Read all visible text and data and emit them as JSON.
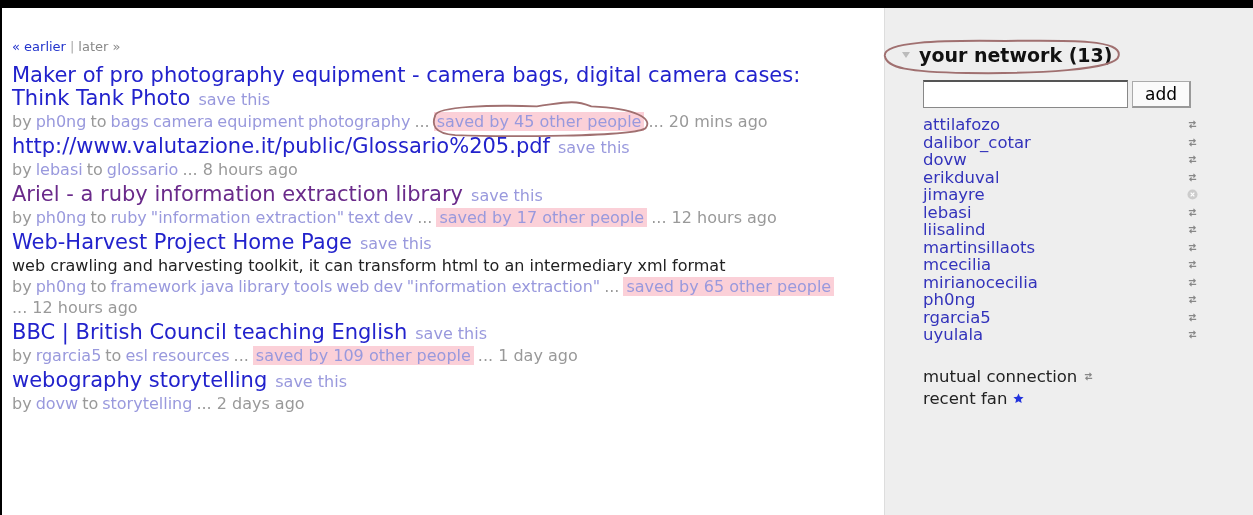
{
  "pager": {
    "earlier": "« earlier",
    "separator": "|",
    "later": "later »"
  },
  "bookmarks": [
    {
      "title_lines": [
        "Maker of pro photography equipment - camera bags, digital camera cases:",
        "Think Tank Photo"
      ],
      "visited": false,
      "save": "save this",
      "by": "by",
      "user": "ph0ng",
      "to": "to",
      "tags": [
        "bags",
        "camera",
        "equipment",
        "photography"
      ],
      "ellipsis": "...",
      "saved": "saved by 45 other people",
      "circled": true,
      "time": "... 20 mins ago"
    },
    {
      "title": "http://www.valutazione.it/public/Glossario%205.pdf",
      "visited": false,
      "save": "save this",
      "by": "by",
      "user": "lebasi",
      "to": "to",
      "tags": [
        "glossario"
      ],
      "time": "... 8 hours ago"
    },
    {
      "title": "Ariel - a ruby information extraction library",
      "visited": true,
      "save": "save this",
      "by": "by",
      "user": "ph0ng",
      "to": "to",
      "tags": [
        "ruby",
        "\"information extraction\"",
        "text",
        "dev"
      ],
      "ellipsis": "...",
      "saved": "saved by 17 other people",
      "circled": false,
      "time": "... 12 hours ago"
    },
    {
      "title": "Web-Harvest Project Home Page",
      "visited": false,
      "save": "save this",
      "description": "web crawling and harvesting toolkit, it can transform html to an intermediary xml format",
      "by": "by",
      "user": "ph0ng",
      "to": "to",
      "tags": [
        "framework",
        "java",
        "library",
        "tools",
        "web",
        "dev",
        "\"information extraction\""
      ],
      "ellipsis": "...",
      "saved": "saved by 65 other people",
      "circled": false,
      "time": "... 12 hours ago"
    },
    {
      "title": "BBC | British Council teaching English",
      "visited": false,
      "save": "save this",
      "by": "by",
      "user": "rgarcia5",
      "to": "to",
      "tags": [
        "esl",
        "resources"
      ],
      "ellipsis": "...",
      "saved": "saved by 109 other people",
      "circled": false,
      "time": "... 1 day ago"
    },
    {
      "title": "webography storytelling",
      "visited": false,
      "save": "save this",
      "by": "by",
      "user": "dovw",
      "to": "to",
      "tags": [
        "storytelling"
      ],
      "time": "... 2 days ago"
    }
  ],
  "network": {
    "title": "your network (13)",
    "expanded": true,
    "circled": true,
    "add": "add",
    "members": [
      {
        "name": "attilafozo",
        "kind": "mutual"
      },
      {
        "name": "dalibor_cotar",
        "kind": "mutual"
      },
      {
        "name": "dovw",
        "kind": "mutual"
      },
      {
        "name": "erikduval",
        "kind": "mutual"
      },
      {
        "name": "jimayre",
        "kind": "removed"
      },
      {
        "name": "lebasi",
        "kind": "mutual"
      },
      {
        "name": "liisalind",
        "kind": "mutual"
      },
      {
        "name": "martinsillaots",
        "kind": "mutual"
      },
      {
        "name": "mcecilia",
        "kind": "mutual"
      },
      {
        "name": "mirianocecilia",
        "kind": "mutual"
      },
      {
        "name": "ph0ng",
        "kind": "mutual"
      },
      {
        "name": "rgarcia5",
        "kind": "mutual"
      },
      {
        "name": "uyulala",
        "kind": "mutual"
      }
    ],
    "legend": [
      {
        "label": "mutual connection",
        "kind": "mutual"
      },
      {
        "label": "recent fan",
        "kind": "fan"
      }
    ]
  }
}
